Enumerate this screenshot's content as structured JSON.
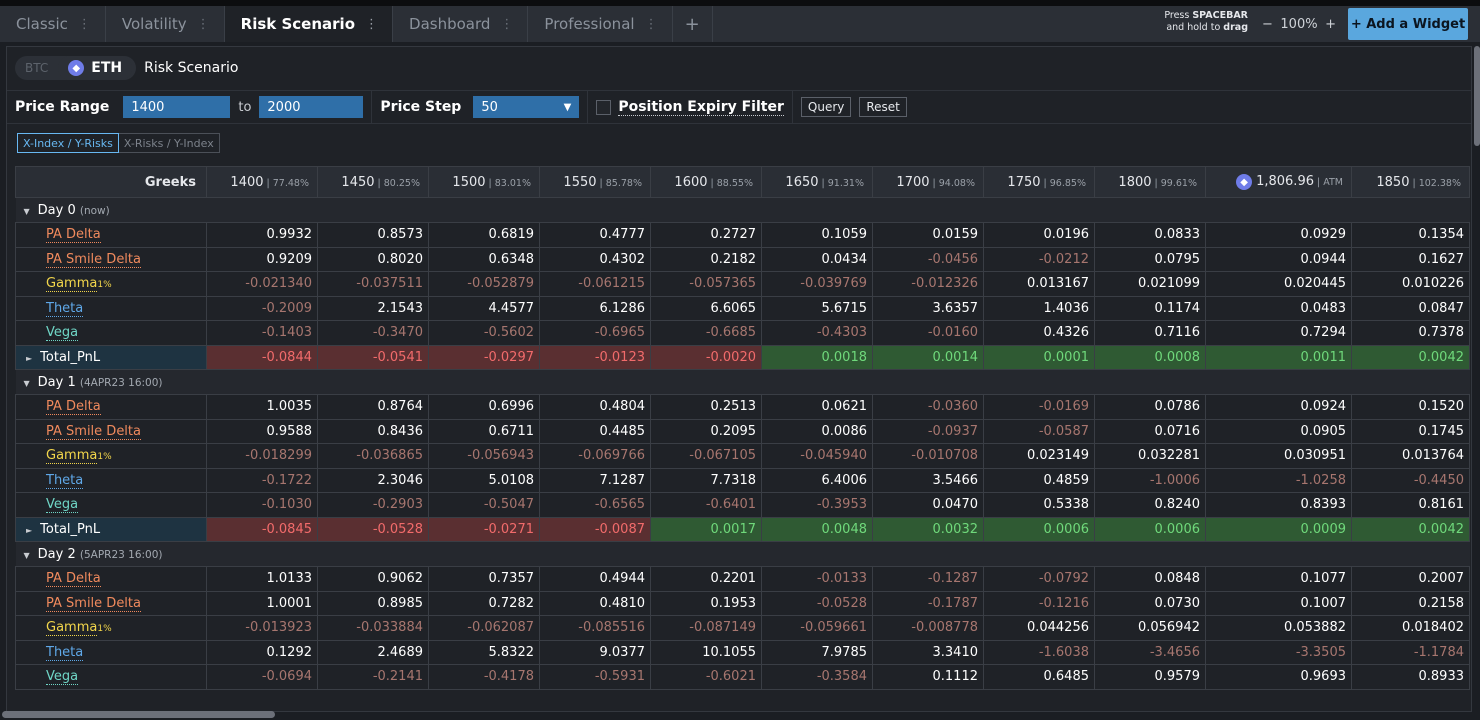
{
  "tabs": [
    {
      "label": "Classic",
      "active": false
    },
    {
      "label": "Volatility",
      "active": false
    },
    {
      "label": "Risk Scenario",
      "active": true
    },
    {
      "label": "Dashboard",
      "active": false
    },
    {
      "label": "Professional",
      "active": false
    }
  ],
  "tab_dots": "⋮",
  "add_tab": "+",
  "hint": {
    "line1_prefix": "Press ",
    "line1_key": "SPACEBAR",
    "line2_prefix": "and hold to ",
    "line2_key": "drag"
  },
  "zoom": {
    "minus": "−",
    "level": "100%",
    "plus": "+"
  },
  "add_widget": "+ Add a Widget",
  "widget": {
    "coin_btc": "BTC",
    "coin_eth": "ETH",
    "title": "Risk Scenario",
    "price_range_label": "Price Range",
    "range_from": "1400",
    "range_to_label": "to",
    "range_to": "2000",
    "price_step_label": "Price Step",
    "price_step": "50",
    "expiry_filter_label": "Position Expiry Filter",
    "query_button": "Query",
    "reset_button": "Reset",
    "axis_on": "X-Index / Y-Risks",
    "axis_off": "X-Risks / Y-Index"
  },
  "table": {
    "greeks_header": "Greeks",
    "columns": [
      {
        "price": "1400",
        "pct": "77.48%"
      },
      {
        "price": "1450",
        "pct": "80.25%"
      },
      {
        "price": "1500",
        "pct": "83.01%"
      },
      {
        "price": "1550",
        "pct": "85.78%"
      },
      {
        "price": "1600",
        "pct": "88.55%"
      },
      {
        "price": "1650",
        "pct": "91.31%"
      },
      {
        "price": "1700",
        "pct": "94.08%"
      },
      {
        "price": "1750",
        "pct": "96.85%"
      },
      {
        "price": "1800",
        "pct": "99.61%"
      },
      {
        "price": "1,806.96",
        "pct": "ATM",
        "atm": true
      },
      {
        "price": "1850",
        "pct": "102.38%"
      }
    ],
    "days": [
      {
        "label": "Day 0",
        "note": "(now)",
        "rows": [
          {
            "name": "PA Delta",
            "color": "orange",
            "values": [
              "0.9932",
              "0.8573",
              "0.6819",
              "0.4777",
              "0.2727",
              "0.1059",
              "0.0159",
              "0.0196",
              "0.0833",
              "0.0929",
              "0.1354"
            ]
          },
          {
            "name": "PA Smile Delta",
            "color": "orange",
            "values": [
              "0.9209",
              "0.8020",
              "0.6348",
              "0.4302",
              "0.2182",
              "0.0434",
              "-0.0456",
              "-0.0212",
              "0.0795",
              "0.0944",
              "0.1627"
            ]
          },
          {
            "name": "Gamma",
            "sub": "1%",
            "color": "yellow",
            "values": [
              "-0.021340",
              "-0.037511",
              "-0.052879",
              "-0.061215",
              "-0.057365",
              "-0.039769",
              "-0.012326",
              "0.013167",
              "0.021099",
              "0.020445",
              "0.010226"
            ]
          },
          {
            "name": "Theta",
            "color": "blue",
            "values": [
              "-0.2009",
              "2.1543",
              "4.4577",
              "6.1286",
              "6.6065",
              "5.6715",
              "3.6357",
              "1.4036",
              "0.1174",
              "0.0483",
              "0.0847"
            ]
          },
          {
            "name": "Vega",
            "color": "teal",
            "values": [
              "-0.1403",
              "-0.3470",
              "-0.5602",
              "-0.6965",
              "-0.6685",
              "-0.4303",
              "-0.0160",
              "0.4326",
              "0.7116",
              "0.7294",
              "0.7378"
            ]
          },
          {
            "name": "Total_PnL",
            "pnl": true,
            "values": [
              "-0.0844",
              "-0.0541",
              "-0.0297",
              "-0.0123",
              "-0.0020",
              "0.0018",
              "0.0014",
              "0.0001",
              "0.0008",
              "0.0011",
              "0.0042"
            ]
          }
        ]
      },
      {
        "label": "Day 1",
        "note": "(4APR23 16:00)",
        "rows": [
          {
            "name": "PA Delta",
            "color": "orange",
            "values": [
              "1.0035",
              "0.8764",
              "0.6996",
              "0.4804",
              "0.2513",
              "0.0621",
              "-0.0360",
              "-0.0169",
              "0.0786",
              "0.0924",
              "0.1520"
            ]
          },
          {
            "name": "PA Smile Delta",
            "color": "orange",
            "values": [
              "0.9588",
              "0.8436",
              "0.6711",
              "0.4485",
              "0.2095",
              "0.0086",
              "-0.0937",
              "-0.0587",
              "0.0716",
              "0.0905",
              "0.1745"
            ]
          },
          {
            "name": "Gamma",
            "sub": "1%",
            "color": "yellow",
            "values": [
              "-0.018299",
              "-0.036865",
              "-0.056943",
              "-0.069766",
              "-0.067105",
              "-0.045940",
              "-0.010708",
              "0.023149",
              "0.032281",
              "0.030951",
              "0.013764"
            ]
          },
          {
            "name": "Theta",
            "color": "blue",
            "values": [
              "-0.1722",
              "2.3046",
              "5.0108",
              "7.1287",
              "7.7318",
              "6.4006",
              "3.5466",
              "0.4859",
              "-1.0006",
              "-1.0258",
              "-0.4450"
            ]
          },
          {
            "name": "Vega",
            "color": "teal",
            "values": [
              "-0.1030",
              "-0.2903",
              "-0.5047",
              "-0.6565",
              "-0.6401",
              "-0.3953",
              "0.0470",
              "0.5338",
              "0.8240",
              "0.8393",
              "0.8161"
            ]
          },
          {
            "name": "Total_PnL",
            "pnl": true,
            "values": [
              "-0.0845",
              "-0.0528",
              "-0.0271",
              "-0.0087",
              "0.0017",
              "0.0048",
              "0.0032",
              "0.0006",
              "0.0006",
              "0.0009",
              "0.0042"
            ]
          }
        ]
      },
      {
        "label": "Day 2",
        "note": "(5APR23 16:00)",
        "rows": [
          {
            "name": "PA Delta",
            "color": "orange",
            "values": [
              "1.0133",
              "0.9062",
              "0.7357",
              "0.4944",
              "0.2201",
              "-0.0133",
              "-0.1287",
              "-0.0792",
              "0.0848",
              "0.1077",
              "0.2007"
            ]
          },
          {
            "name": "PA Smile Delta",
            "color": "orange",
            "values": [
              "1.0001",
              "0.8985",
              "0.7282",
              "0.4810",
              "0.1953",
              "-0.0528",
              "-0.1787",
              "-0.1216",
              "0.0730",
              "0.1007",
              "0.2158"
            ]
          },
          {
            "name": "Gamma",
            "sub": "1%",
            "color": "yellow",
            "values": [
              "-0.013923",
              "-0.033884",
              "-0.062087",
              "-0.085516",
              "-0.087149",
              "-0.059661",
              "-0.008778",
              "0.044256",
              "0.056942",
              "0.053882",
              "0.018402"
            ]
          },
          {
            "name": "Theta",
            "color": "blue",
            "values": [
              "0.1292",
              "2.4689",
              "5.8322",
              "9.0377",
              "10.1055",
              "7.9785",
              "3.3410",
              "-1.6038",
              "-3.4656",
              "-3.3505",
              "-1.1784"
            ]
          },
          {
            "name": "Vega",
            "color": "teal",
            "values": [
              "-0.0694",
              "-0.2141",
              "-0.4178",
              "-0.5931",
              "-0.6021",
              "-0.3584",
              "0.1112",
              "0.6485",
              "0.9579",
              "0.9693",
              "0.8933"
            ]
          }
        ]
      }
    ]
  }
}
